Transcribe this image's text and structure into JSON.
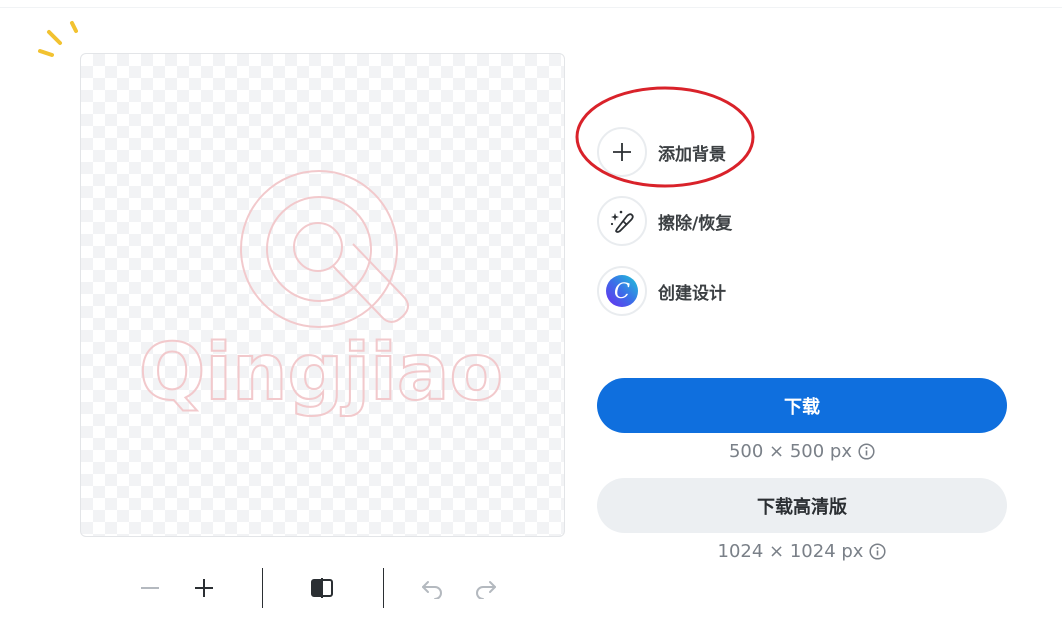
{
  "canvas": {
    "logo_text": "Qingjiao"
  },
  "options": [
    {
      "label": "添加背景",
      "icon": "plus-icon"
    },
    {
      "label": "擦除/恢复",
      "icon": "magic-brush-icon"
    },
    {
      "label": "创建设计",
      "icon": "canva-logo-icon",
      "logo_letter": "C"
    }
  ],
  "download": {
    "label": "下载",
    "size_text": "500 × 500 px"
  },
  "download_hd": {
    "label": "下载高清版",
    "size_text": "1024 × 1024 px"
  },
  "toolbar": {
    "icons": [
      "zoom-out-icon",
      "zoom-in-icon",
      "compare-icon",
      "undo-icon",
      "redo-icon"
    ]
  },
  "colors": {
    "primary": "#0f6fde",
    "secondary_bg": "#eceff2",
    "highlight": "#d9222a",
    "sparkle": "#f2c230",
    "logo_outline": "#f2c9cc"
  }
}
